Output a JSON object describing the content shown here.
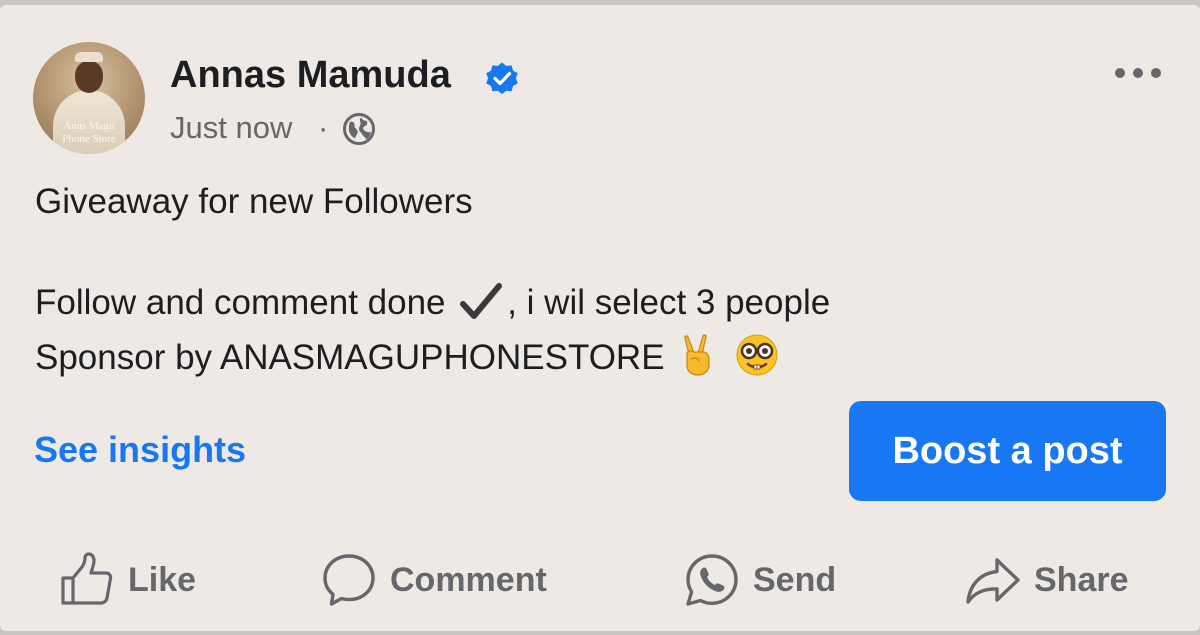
{
  "post": {
    "author": {
      "name": "Annas Mamuda",
      "verified": true,
      "avatar_watermark_line1": "Anas Magu",
      "avatar_watermark_line2": "Phone Store"
    },
    "timestamp": "Just now",
    "separator": "·",
    "audience_icon": "globe-icon",
    "text_line1": "Giveaway for new Followers",
    "text_line2_before": "Follow and comment done",
    "text_line2_after": ", i wil select 3 people",
    "text_line3": "Sponsor by ANASMAGUPHONESTORE",
    "emojis": [
      "check-mark-emoji",
      "victory-hand-emoji",
      "nerd-face-emoji"
    ]
  },
  "insights_label": "See insights",
  "boost_label": "Boost a post",
  "actions": [
    {
      "icon": "thumbs-up-icon",
      "label": "Like"
    },
    {
      "icon": "comment-bubble-icon",
      "label": "Comment"
    },
    {
      "icon": "whatsapp-icon",
      "label": "Send"
    },
    {
      "icon": "share-arrow-icon",
      "label": "Share"
    }
  ],
  "colors": {
    "background": "#efe9e5",
    "accent": "#1877f2",
    "text": "#1c1e21",
    "secondary_text": "#65676b"
  }
}
